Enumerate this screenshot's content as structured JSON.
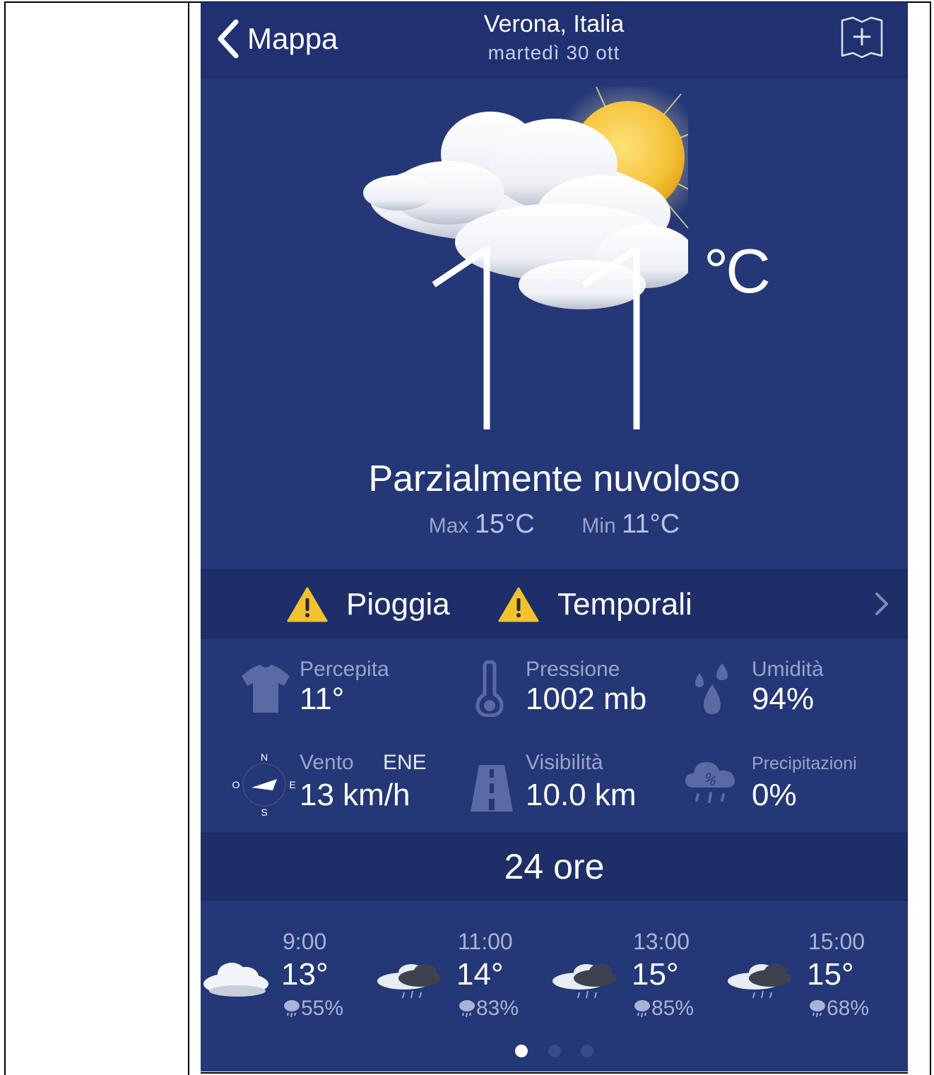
{
  "header": {
    "back_label": "Mappa",
    "city": "Verona, Italia",
    "date": "martedì 30 ott"
  },
  "current": {
    "temperature": "11",
    "unit": "°C",
    "condition": "Parzialmente nuvoloso",
    "max_label": "Max",
    "max_value": "15°C",
    "min_label": "Min",
    "min_value": "11°C",
    "icon": "partly-cloudy-sun-icon"
  },
  "alerts": [
    {
      "label": "Pioggia",
      "icon": "warning-icon"
    },
    {
      "label": "Temporali",
      "icon": "warning-icon"
    }
  ],
  "stats": {
    "percepita": {
      "label": "Percepita",
      "value": "11°",
      "icon": "tshirt-icon"
    },
    "pressione": {
      "label": "Pressione",
      "value": "1002 mb",
      "icon": "thermometer-icon"
    },
    "umidita": {
      "label": "Umidità",
      "value": "94%",
      "icon": "water-drops-icon"
    },
    "vento": {
      "label": "Vento",
      "direction": "ENE",
      "value": "13 km/h",
      "icon": "compass-icon",
      "compass": {
        "n": "N",
        "e": "E",
        "s": "S",
        "w": "O"
      }
    },
    "visibilita": {
      "label": "Visibilità",
      "value": "10.0 km",
      "icon": "road-icon"
    },
    "precipitazioni": {
      "label": "Precipitazioni",
      "value": "0%",
      "icon": "rain-cloud-percent-icon"
    }
  },
  "hourly_section": {
    "title": "24 ore"
  },
  "hourly": [
    {
      "time": "9:00",
      "temp": "13°",
      "rain": "55%",
      "icon": "cloud-icon"
    },
    {
      "time": "11:00",
      "temp": "14°",
      "rain": "83%",
      "icon": "rain-cloud-icon"
    },
    {
      "time": "13:00",
      "temp": "15°",
      "rain": "85%",
      "icon": "rain-cloud-icon"
    },
    {
      "time": "15:00",
      "temp": "15°",
      "rain": "68%",
      "icon": "rain-cloud-icon"
    }
  ],
  "pagination": {
    "pages": 3,
    "active": 1
  },
  "colors": {
    "background": "#243777",
    "header": "#1f3170",
    "band": "#1d2e68",
    "warning": "#f2c12e",
    "muted": "#9aa4c8"
  }
}
